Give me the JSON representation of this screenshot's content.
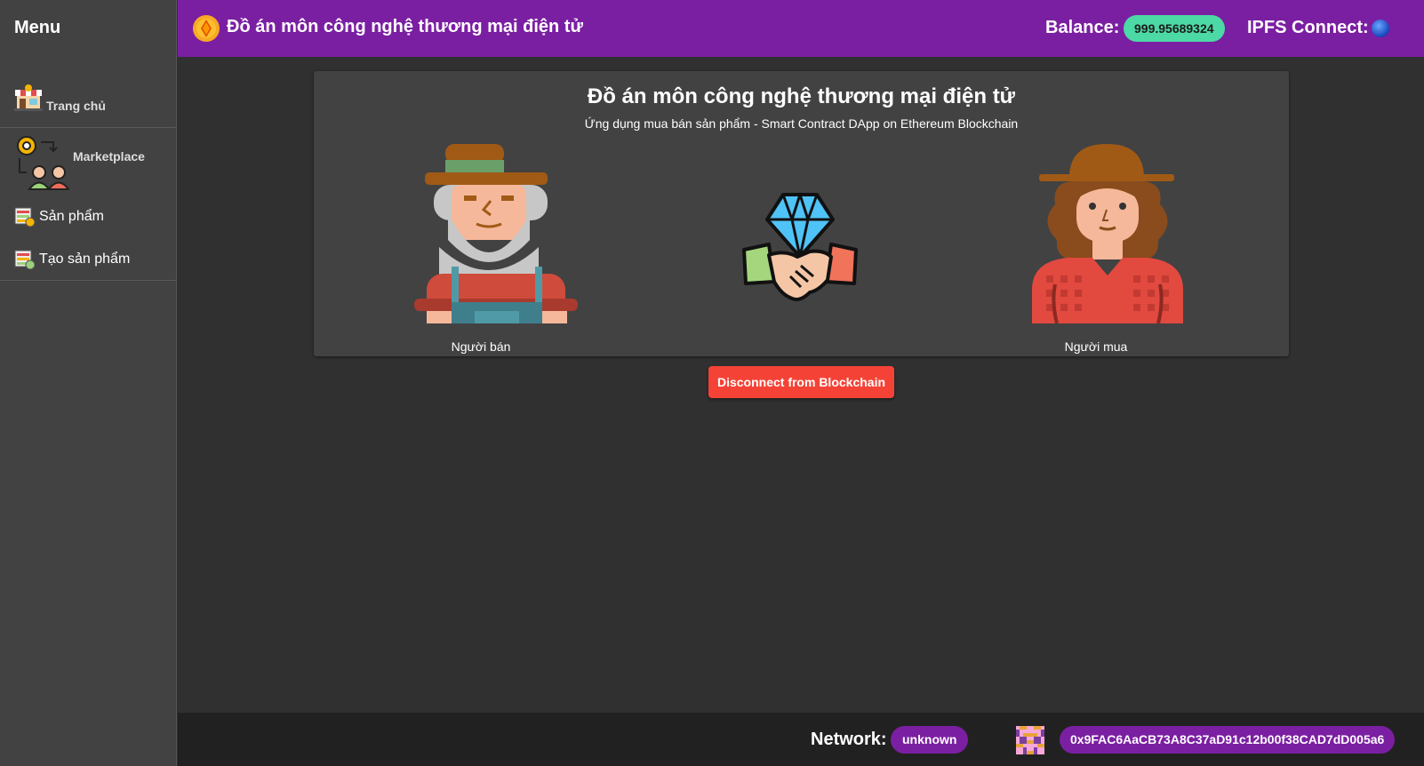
{
  "sidebar": {
    "title": "Menu",
    "items": [
      {
        "label": "Trang chủ",
        "icon": "store-icon"
      },
      {
        "label": "Marketplace",
        "icon": "marketplace-icon"
      },
      {
        "label": "Sản phẩm",
        "icon": "product-list-icon"
      },
      {
        "label": "Tạo sản phẩm",
        "icon": "create-product-icon"
      }
    ]
  },
  "header": {
    "title": "Đồ án môn công nghệ thương mại điện tử",
    "balance_label": "Balance:",
    "balance_value": "999.95689324",
    "ipfs_label": "IPFS Connect:"
  },
  "card": {
    "title": "Đồ án môn công nghệ thương mại điện tử",
    "subtitle": "Ứng dụng mua bán sản phẩm - Smart Contract DApp on Ethereum Blockchain",
    "seller_label": "Người bán",
    "buyer_label": "Người mua"
  },
  "actions": {
    "disconnect_label": "Disconnect from Blockchain"
  },
  "footer": {
    "network_label": "Network:",
    "network_value": "unknown",
    "address": "0x9FAC6AaCB73A8C37aD91c12b00f38CAD7dD005a6"
  },
  "colors": {
    "header": "#7b1fa2",
    "sidebar": "#424242",
    "background": "#303030",
    "footer": "#212121",
    "balance_chip": "#4cd9a6",
    "disconnect": "#f44336",
    "ipfs_status": "#1e5fd6"
  }
}
